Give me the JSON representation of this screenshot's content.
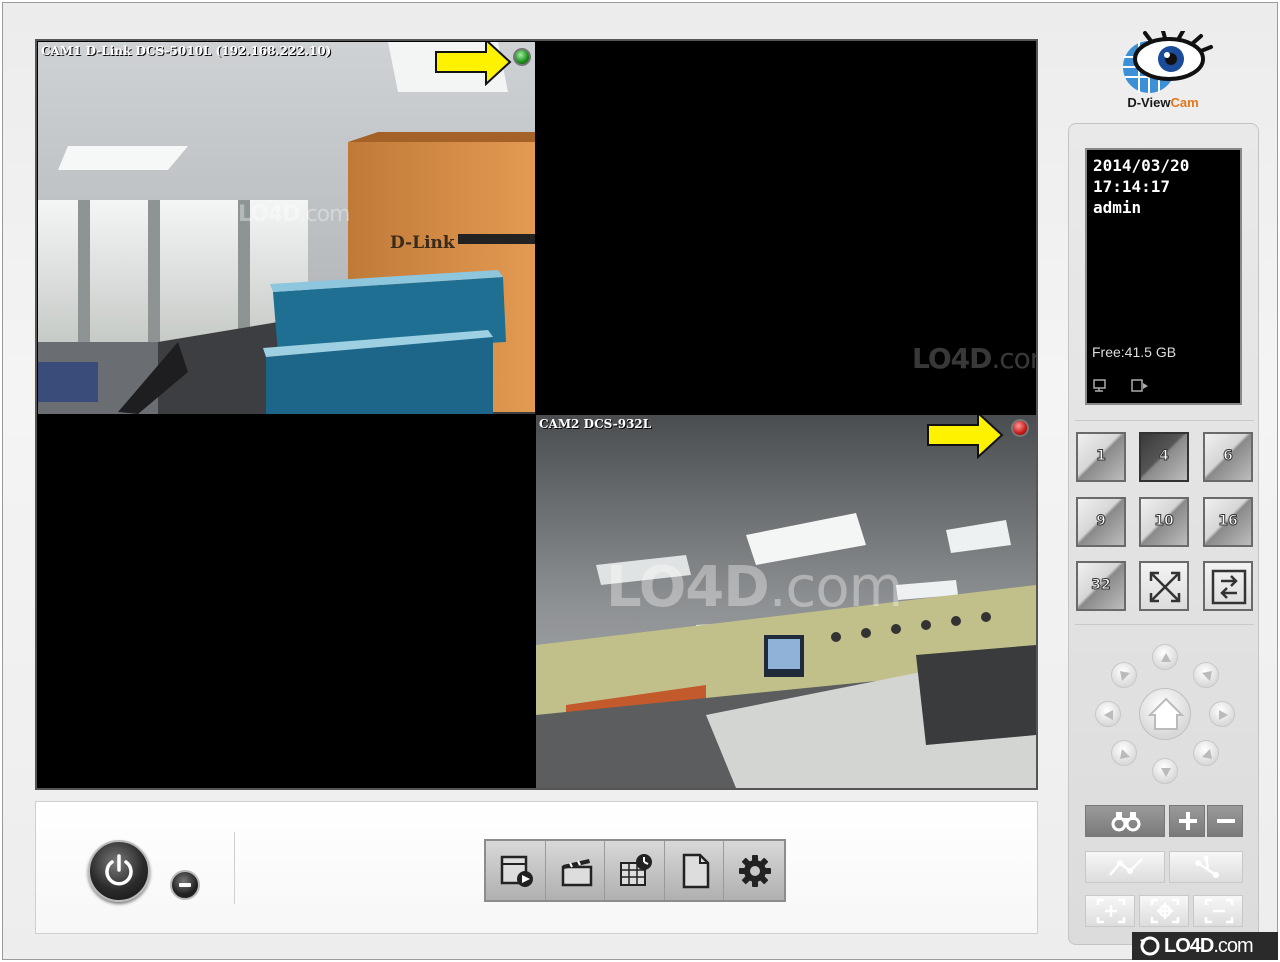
{
  "app": {
    "name": "D-ViewCam",
    "logo_text_a": "D-View",
    "logo_text_b": "Cam",
    "accent_color": "#e0781a"
  },
  "cameras": [
    {
      "title": "CAM1 D-Link DCS-5010L (192.168.222.10)",
      "status": "green",
      "scene_label": "D-Link"
    },
    {
      "title": "",
      "status": "none"
    },
    {
      "title": "",
      "status": "none"
    },
    {
      "title": "CAM2 DCS-932L",
      "status": "red"
    }
  ],
  "status_panel": {
    "date": "2014/03/20",
    "time": "17:14:17",
    "user": "admin",
    "free_space": "Free:41.5 GB",
    "mini_icons": [
      "monitor-icon",
      "playback-icon"
    ]
  },
  "layouts": [
    {
      "label": "1",
      "active": false
    },
    {
      "label": "4",
      "active": true
    },
    {
      "label": "6",
      "active": false
    },
    {
      "label": "9",
      "active": false
    },
    {
      "label": "10",
      "active": false
    },
    {
      "label": "16",
      "active": false
    },
    {
      "label": "32",
      "active": false
    },
    {
      "label": "",
      "icon": "fullscreen-icon",
      "active": false
    },
    {
      "label": "",
      "icon": "swap-icon",
      "active": false
    }
  ],
  "toolbar": {
    "items": [
      "playback-icon",
      "video-clip-icon",
      "schedule-icon",
      "document-icon",
      "settings-icon"
    ]
  },
  "ptz_controls": [
    "up",
    "up-right",
    "right",
    "down-right",
    "down",
    "down-left",
    "left",
    "up-left",
    "home"
  ],
  "bottom_controls": [
    "binoculars-icon",
    "zoom-in-icon",
    "zoom-out-icon",
    "path-icon",
    "share-icon",
    "focus-near-icon",
    "focus-center-icon",
    "focus-far-icon"
  ],
  "watermark": {
    "brand": "LO4D",
    "suffix": ".com"
  }
}
